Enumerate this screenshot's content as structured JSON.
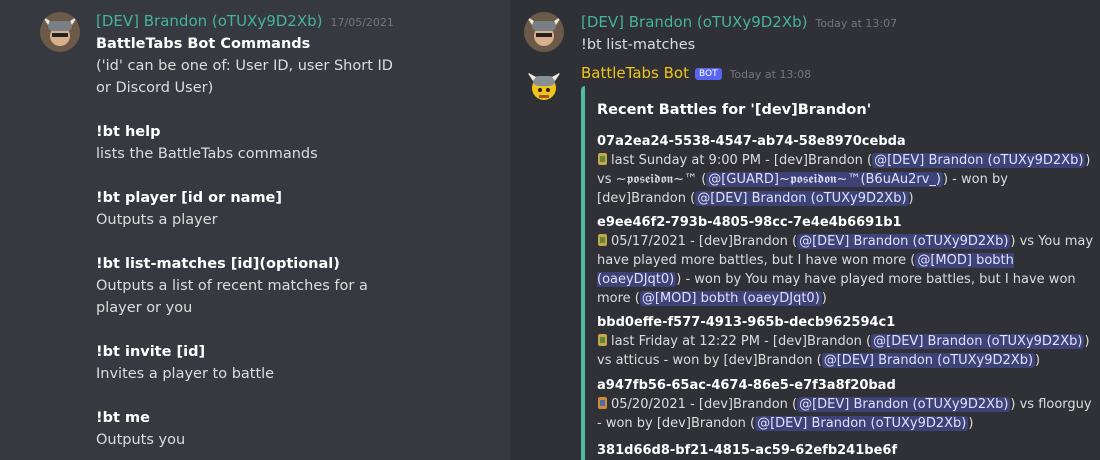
{
  "left": {
    "author": "[DEV] Brandon (oTUXy9D2Xb)",
    "timestamp": "17/05/2021",
    "title": "BattleTabs Bot Commands",
    "note": "('id' can be one of: User ID, user Short ID or Discord User)",
    "commands": [
      {
        "name": "!bt help",
        "desc": "lists the BattleTabs commands"
      },
      {
        "name": "!bt player [id or name]",
        "desc": "Outputs a player"
      },
      {
        "name": "!bt list-matches [id](optional)",
        "desc": "Outputs a list of recent matches for a player or you"
      },
      {
        "name": "!bt invite [id]",
        "desc": "Invites a player to battle"
      },
      {
        "name": "!bt me",
        "desc": "Outputs you"
      }
    ]
  },
  "right": {
    "user_msg": {
      "author": "[DEV] Brandon (oTUXy9D2Xb)",
      "timestamp": "Today at 13:07",
      "text": "!bt list-matches"
    },
    "bot_msg": {
      "author": "BattleTabs Bot",
      "tag": "BOT",
      "timestamp": "Today at 13:08"
    },
    "embed": {
      "title": "Recent Battles for '[dev]Brandon'",
      "matches": [
        {
          "id": "07a2ea24-5538-4547-ab74-58e8970cebda",
          "t1": "last Sunday at 9:00 PM - [dev]Brandon (",
          "m1": "@[DEV] Brandon (oTUXy9D2Xb)",
          "t2": ") vs ~𝖕𝖔𝖘𝖊𝖎𝖉𝖔𝖓~™ (",
          "m2": "@[GUARD]~𝖕𝖔𝖘𝖊𝖎𝖉𝖔𝖓~™(B6uAu2rv_)",
          "t3": ") - won by [dev]Brandon (",
          "m3": "@[DEV] Brandon (oTUXy9D2Xb)",
          "t4": ")"
        },
        {
          "id": "e9ee46f2-793b-4805-98cc-7e4e4b6691b1",
          "t1": "05/17/2021 - [dev]Brandon (",
          "m1": "@[DEV] Brandon (oTUXy9D2Xb)",
          "t2": ") vs You may have played more battles, but I have won more (",
          "m2": "@[MOD] bobth (oaeyDJqt0)",
          "t3": ") - won by You may have played more battles, but I have won more (",
          "m3": "@[MOD] bobth (oaeyDJqt0)",
          "t4": ")"
        },
        {
          "id": "bbd0effe-f577-4913-965b-decb962594c1",
          "t1": "last Friday at 12:22 PM - [dev]Brandon (",
          "m1": "@[DEV] Brandon (oTUXy9D2Xb)",
          "t2": ") vs atticus - won by [dev]Brandon (",
          "m2": "@[DEV] Brandon (oTUXy9D2Xb)",
          "t3": ")",
          "m3": "",
          "t4": ""
        },
        {
          "id": "a947fb56-65ac-4674-86e5-e7f3a8f20bad",
          "t1": "05/20/2021 - [dev]Brandon (",
          "m1": "@[DEV] Brandon (oTUXy9D2Xb)",
          "t2": ") vs floorguy - won by [dev]Brandon (",
          "m2": "@[DEV] Brandon (oTUXy9D2Xb)",
          "t3": ")",
          "m3": "",
          "t4": ""
        },
        {
          "id": "381d66d8-bf21-4815-ac59-62efb241be6f",
          "t1": "",
          "m1": "",
          "t2": "",
          "m2": "",
          "t3": "",
          "m3": "",
          "t4": ""
        }
      ]
    }
  },
  "colors": {
    "background_left": "#36393f",
    "background_right": "#2f3136",
    "user_name": "#45b39d",
    "bot_name": "#f0c419",
    "bot_tag": "#5865f2",
    "embed_border": "#4fbfa0",
    "mention_bg": "#4a4f8a"
  }
}
